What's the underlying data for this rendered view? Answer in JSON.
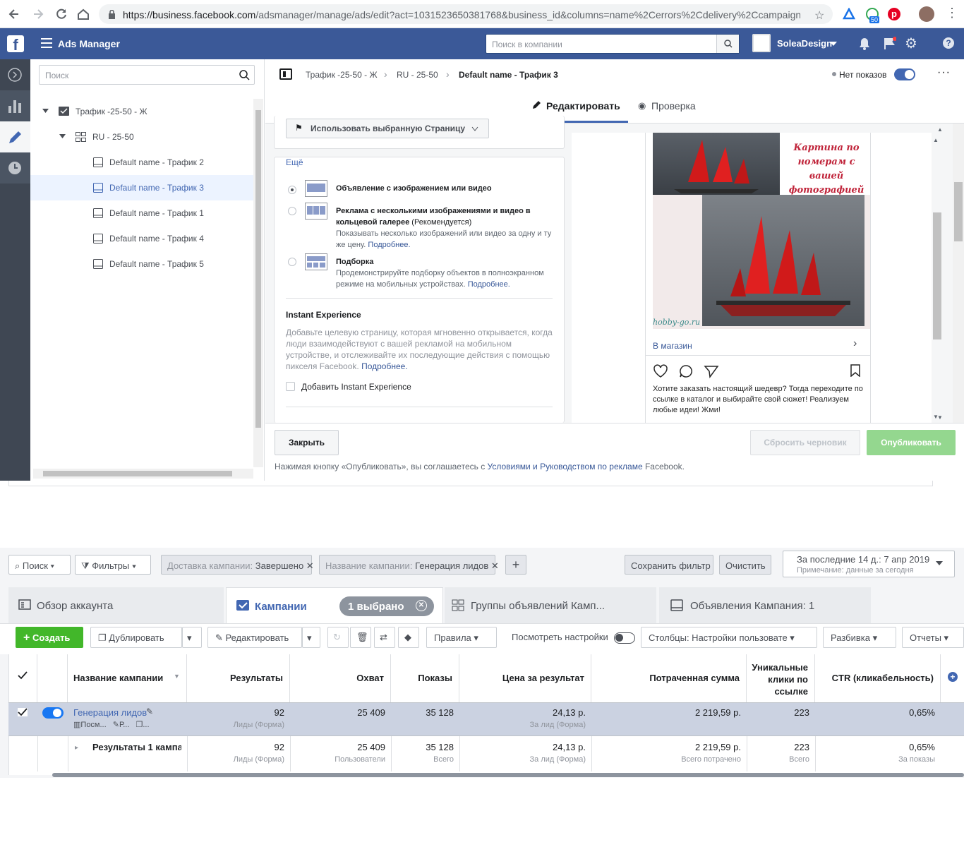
{
  "browser": {
    "url_host": "https://business.facebook.com",
    "url_path": "/adsmanager/manage/ads/edit?act=1031523650381768&business_id&columns=name%2Cerrors%2Cdelivery%2Ccampaign...",
    "ext_badge": "50"
  },
  "header": {
    "app_title": "Ads Manager",
    "search_placeholder": "Поиск в компании",
    "account_name": "SoleaDesign"
  },
  "tree": {
    "search_placeholder": "Поиск",
    "campaign": "Трафик -25-50 - Ж",
    "adset": "RU - 25-50",
    "ads": [
      "Default name - Трафик 2",
      "Default name - Трафик 3",
      "Default name - Трафик 1",
      "Default name - Трафик 4",
      "Default name - Трафик 5"
    ]
  },
  "editor": {
    "breadcrumb": [
      "Трафик -25-50 - Ж",
      "RU - 25-50",
      "Default name - Трафик 3"
    ],
    "status": "Нет показов",
    "tab_edit": "Редактировать",
    "tab_review": "Проверка",
    "page_select": "Использовать выбранную Страницу",
    "more": "Ещё",
    "formats": [
      {
        "title": "Объявление с изображением или видео",
        "note": "",
        "desc": "",
        "more": ""
      },
      {
        "title": "Реклама с несколькими изображениями и видео в кольцевой галерее",
        "note": " (Рекомендуется)",
        "desc": "Показывать несколько изображений или видео за одну и ту же цену. ",
        "more": "Подробнее."
      },
      {
        "title": "Подборка",
        "note": "",
        "desc": "Продемонстрируйте подборку объектов в полноэкранном режиме на мобильных устройствах. ",
        "more": "Подробнее."
      }
    ],
    "ie_title": "Instant Experience",
    "ie_desc": "Добавьте целевую страницу, которая мгновенно открывается, когда люди взаимодействуют с вашей рекламой на мобильном устройстве, и отслеживайте их последующие действия с помощью пикселя Facebook. ",
    "ie_more": "Подробнее.",
    "ie_checkbox": "Добавить Instant Experience",
    "close_btn": "Закрыть",
    "reset_btn": "Сбросить черновик",
    "publish_btn": "Опубликовать",
    "terms_pre": "Нажимая кнопку «Опубликовать», вы соглашаетесь с ",
    "terms_link": "Условиями и Руководством по рекламе",
    "terms_post": " Facebook."
  },
  "preview": {
    "image_text": "Картина по номерам с вашей фотографией",
    "watermark": "hobby-go.ru",
    "cta": "В магазин",
    "caption": "Хотите заказать настоящий шедевр? Тогда переходите по ссылке в каталог и выбирайте свой сюжет! Реализуем любые идеи! Жми!"
  },
  "table_view": {
    "search": "Поиск",
    "filters": "Фильтры",
    "filter1_key": "Доставка кампании:",
    "filter1_val": "Завершено",
    "filter2_key": "Название кампании:",
    "filter2_val": "Генерация лидов",
    "save_filter": "Сохранить фильтр",
    "clear": "Очистить",
    "date_range": "За последние 14 д.: 7 апр 2019",
    "date_note": "Примечание: данные за сегодня",
    "tabs": [
      "Обзор аккаунта",
      "Кампании",
      "Группы объявлений Камп...",
      "Объявления Кампания: 1"
    ],
    "selected_badge": "1 выбрано",
    "toolbar": {
      "create": "Создать",
      "duplicate": "Дублировать",
      "edit": "Редактировать",
      "rules": "Правила",
      "view_settings": "Посмотреть настройки",
      "columns": "Столбцы: Настройки пользовате",
      "breakdown": "Разбивка",
      "reports": "Отчеты"
    },
    "columns": [
      "Название кампании",
      "Результаты",
      "Охват",
      "Показы",
      "Цена за результат",
      "Потраченная сумма",
      "Уникальные клики по ссылке",
      "CTR (кликабельность)"
    ],
    "row": {
      "name": "Генерация лидов",
      "sub1": "Посм...",
      "sub2": "Р...",
      "sub3": "...",
      "results": "92",
      "results_sub": "Лиды (Форма)",
      "reach": "25 409",
      "impressions": "35 128",
      "cpr": "24,13 р.",
      "cpr_sub": "За лид (Форма)",
      "spent": "2 219,59 р.",
      "clicks": "223",
      "ctr": "0,65%"
    },
    "total": {
      "name": "Результаты 1 кампаі",
      "results": "92",
      "results_sub": "Лиды (Форма)",
      "reach": "25 409",
      "reach_sub": "Пользователи",
      "impressions": "35 128",
      "impressions_sub": "Всего",
      "cpr": "24,13 р.",
      "cpr_sub": "За лид (Форма)",
      "spent": "2 219,59 р.",
      "spent_sub": "Всего потрачено",
      "clicks": "223",
      "clicks_sub": "Всего",
      "ctr": "0,65%",
      "ctr_sub": "За показы"
    }
  }
}
